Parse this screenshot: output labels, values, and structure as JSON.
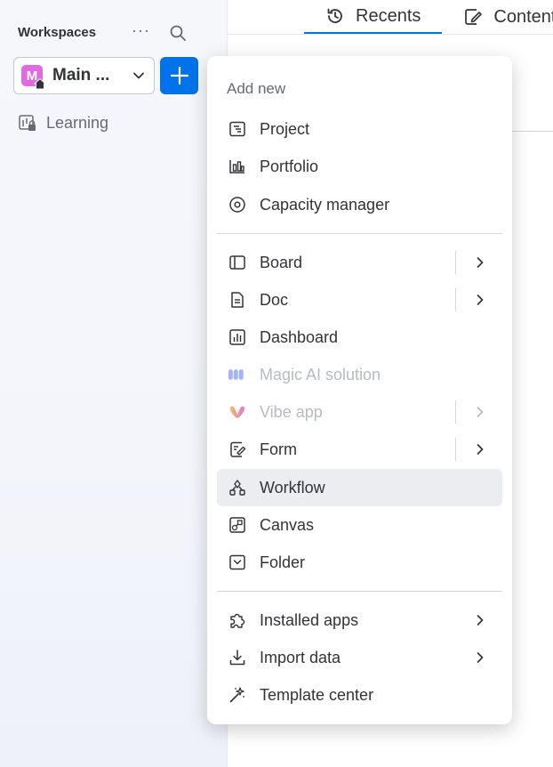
{
  "sidebar": {
    "header": "Workspaces",
    "more": "···",
    "workspace": {
      "initial": "M",
      "name": "Main ...",
      "color": "#e06be0"
    },
    "items": [
      {
        "label": "Learning"
      }
    ]
  },
  "tabs": [
    {
      "label": "Recents",
      "active": true
    },
    {
      "label": "Content",
      "active": false
    }
  ],
  "menu": {
    "title": "Add new",
    "items": [
      {
        "label": "Project",
        "icon": "project-icon"
      },
      {
        "label": "Portfolio",
        "icon": "portfolio-icon"
      },
      {
        "label": "Capacity manager",
        "icon": "capacity-icon"
      },
      {
        "label": "Board",
        "icon": "board-icon",
        "submenu": true
      },
      {
        "label": "Doc",
        "icon": "doc-icon",
        "submenu": true
      },
      {
        "label": "Dashboard",
        "icon": "dashboard-icon"
      },
      {
        "label": "Magic AI solution",
        "icon": "magic-ai-icon",
        "disabled": true
      },
      {
        "label": "Vibe app",
        "icon": "vibe-icon",
        "disabled": true,
        "submenu": true
      },
      {
        "label": "Form",
        "icon": "form-icon",
        "submenu": true
      },
      {
        "label": "Workflow",
        "icon": "workflow-icon",
        "hover": true
      },
      {
        "label": "Canvas",
        "icon": "canvas-icon"
      },
      {
        "label": "Folder",
        "icon": "folder-icon"
      },
      {
        "label": "Installed apps",
        "icon": "puzzle-icon",
        "submenu": true
      },
      {
        "label": "Import data",
        "icon": "download-icon",
        "submenu": true
      },
      {
        "label": "Template center",
        "icon": "magic-wand-icon"
      }
    ]
  },
  "colors": {
    "accent": "#0073ea",
    "text": "#323338",
    "muted": "#676879",
    "disabled": "#b8bac5"
  }
}
